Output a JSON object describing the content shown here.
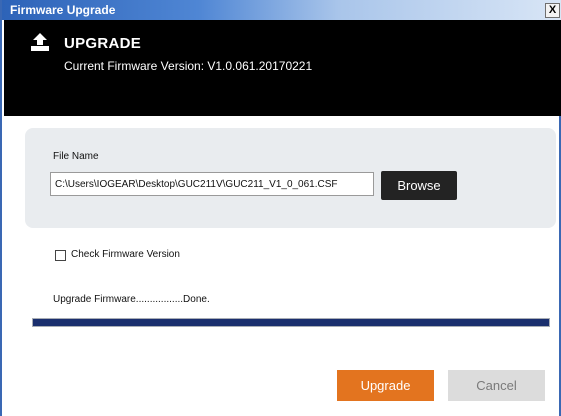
{
  "window": {
    "title": "Firmware Upgrade",
    "close_label": "X"
  },
  "header": {
    "icon": "upload-icon",
    "title": "UPGRADE",
    "version_text": "Current Firmware Version: V1.0.061.20170221"
  },
  "file": {
    "label": "File Name",
    "path_value": "C:\\Users\\IOGEAR\\Desktop\\GUC211V\\GUC211_V1_0_061.CSF",
    "browse_label": "Browse"
  },
  "check_version": {
    "label": "Check Firmware Version",
    "checked": false
  },
  "status": {
    "text": "Upgrade Firmware.................Done.",
    "progress_fraction": 1.0
  },
  "buttons": {
    "upgrade_label": "Upgrade",
    "cancel_label": "Cancel"
  },
  "colors": {
    "title_bar": "#2d63b8",
    "header_bg": "#000000",
    "progress_fill": "#1a2f6e",
    "upgrade_button": "#e3741f",
    "cancel_button": "#dcdcdc",
    "browse_button": "#232323"
  }
}
